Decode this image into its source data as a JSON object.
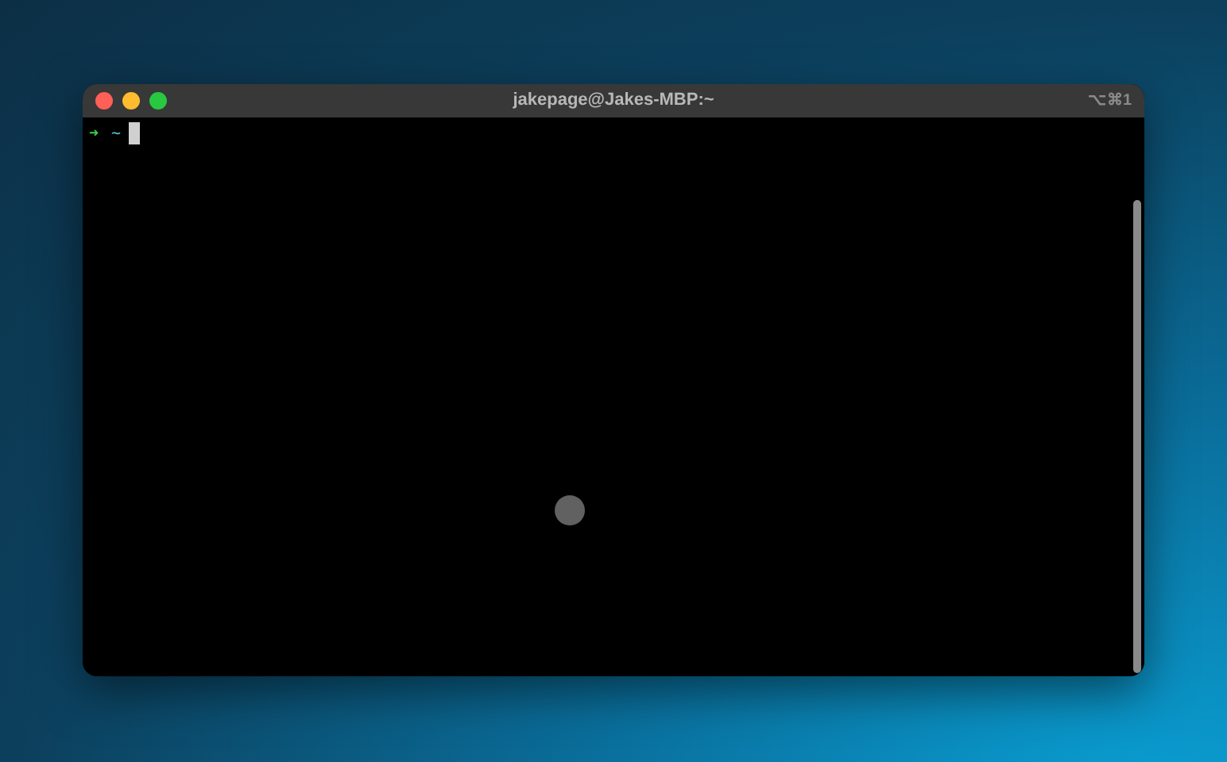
{
  "window": {
    "title": "jakepage@Jakes-MBP:~",
    "shortcut": "⌥⌘1"
  },
  "prompt": {
    "arrow": "➜",
    "cwd": "~"
  }
}
